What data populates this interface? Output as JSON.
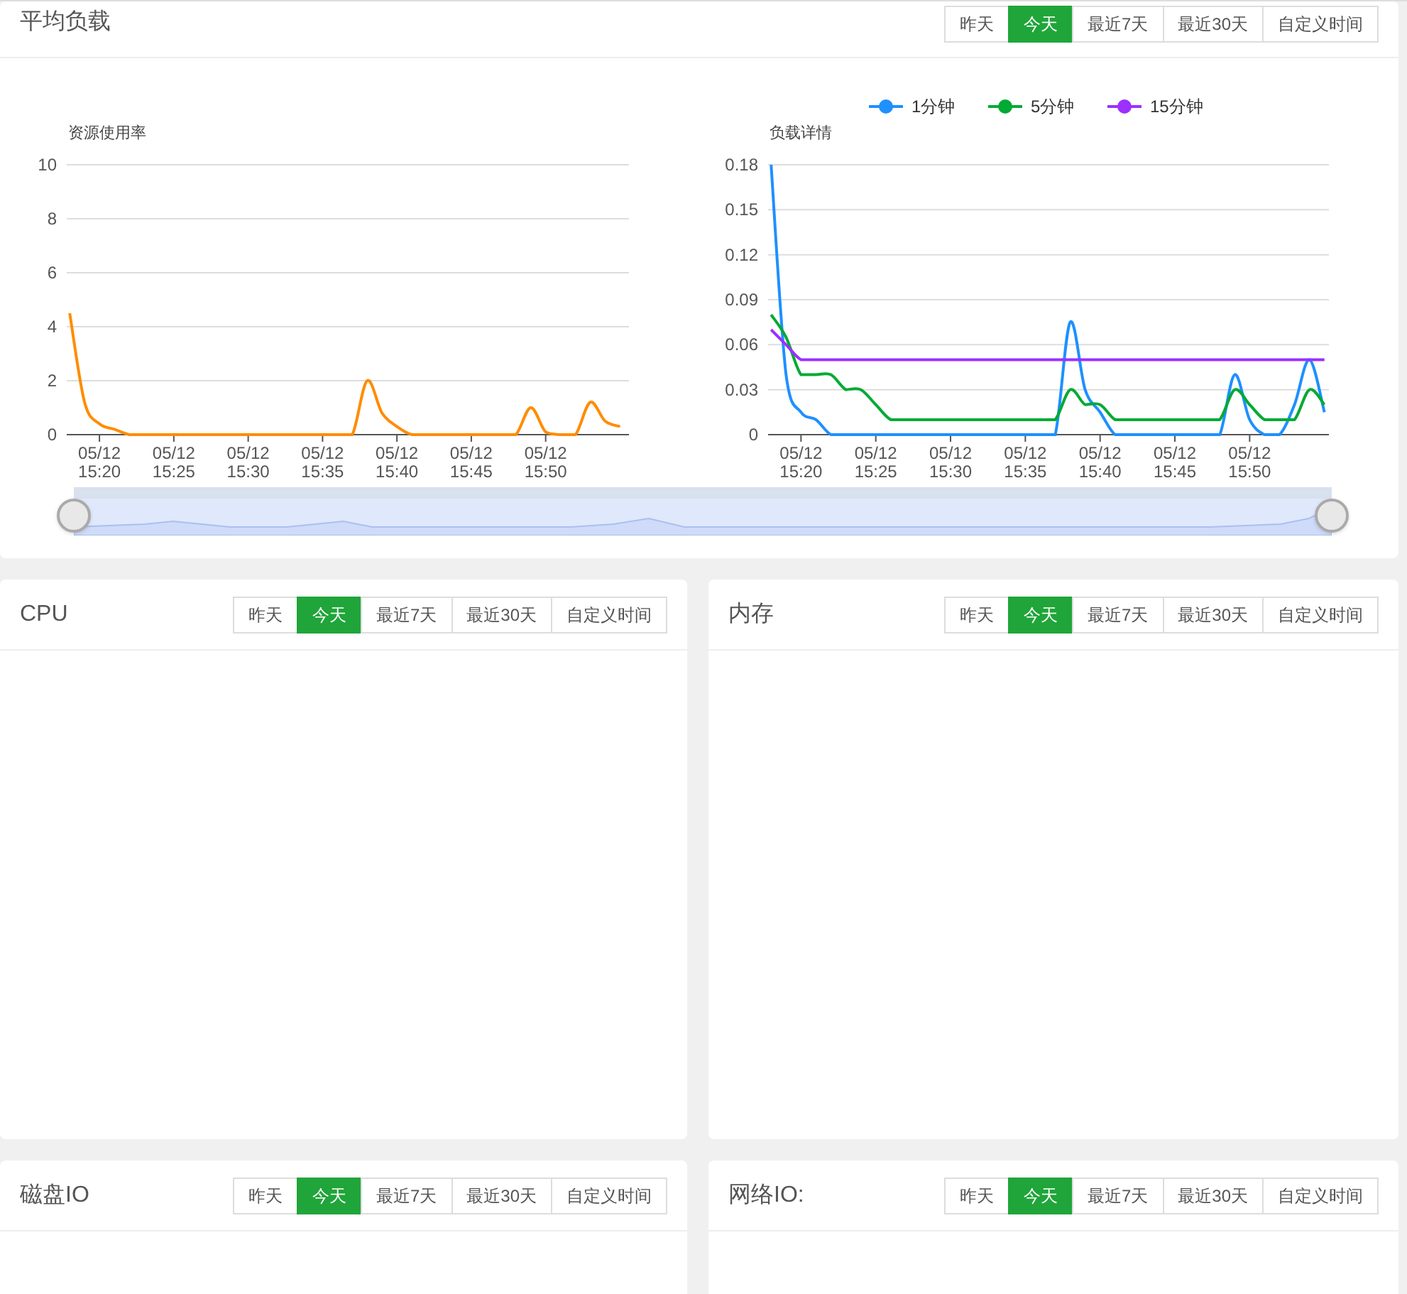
{
  "panels": [
    {
      "title": "平均负载",
      "ranges": [
        {
          "label": "昨天",
          "selected": false
        },
        {
          "label": "今天",
          "selected": true
        },
        {
          "label": "最近7天",
          "selected": false
        },
        {
          "label": "最近30天",
          "selected": false
        },
        {
          "label": "自定义时间",
          "selected": false
        }
      ],
      "charts": [
        {
          "chart_data": {
            "type": "line",
            "grid": true,
            "ylabel": "资源使用率",
            "categories": [
              null,
              null,
              "05/12 15:20",
              null,
              null,
              null,
              null,
              "05/12 15:25",
              null,
              null,
              null,
              null,
              "05/12 15:30",
              null,
              null,
              null,
              null,
              "05/12 15:35",
              null,
              null,
              null,
              null,
              "05/12 15:40",
              null,
              null,
              null,
              null,
              "05/12 15:45",
              null,
              null,
              null,
              null,
              "05/12 15:50",
              null,
              null,
              null,
              null,
              null
            ],
            "ylim": [
              0,
              10
            ],
            "yticks": [
              0,
              2,
              4,
              6,
              8,
              10
            ],
            "series": [
              {
                "color": "#ff8c00",
                "values": [
                  4.5,
                  1.2,
                  0.4,
                  0.2,
                  0,
                  0,
                  0,
                  0,
                  0,
                  0,
                  0,
                  0,
                  0,
                  0,
                  0,
                  0,
                  0,
                  0,
                  0,
                  0,
                  2.0,
                  0.8,
                  0.3,
                  0,
                  0,
                  0,
                  0,
                  0,
                  0,
                  0,
                  0,
                  1.0,
                  0.1,
                  0,
                  0,
                  1.2,
                  0.5,
                  0.3
                ]
              }
            ]
          }
        },
        {
          "chart_data": {
            "type": "line",
            "grid": true,
            "legend": "top",
            "ylabel": "负载详情",
            "categories": [
              null,
              null,
              "05/12 15:20",
              null,
              null,
              null,
              null,
              "05/12 15:25",
              null,
              null,
              null,
              null,
              "05/12 15:30",
              null,
              null,
              null,
              null,
              "05/12 15:35",
              null,
              null,
              null,
              null,
              "05/12 15:40",
              null,
              null,
              null,
              null,
              "05/12 15:45",
              null,
              null,
              null,
              null,
              "05/12 15:50",
              null,
              null,
              null,
              null,
              null
            ],
            "ylim": [
              0,
              0.18
            ],
            "yticks": [
              0,
              0.03,
              0.06,
              0.09,
              0.12,
              0.15,
              0.18
            ],
            "series": [
              {
                "name": "1分钟",
                "color": "#1e90ff",
                "values": [
                  0.18,
                  0.04,
                  0.015,
                  0.01,
                  0,
                  0,
                  0,
                  0,
                  0,
                  0,
                  0,
                  0,
                  0,
                  0,
                  0,
                  0,
                  0,
                  0,
                  0,
                  0,
                  0.075,
                  0.03,
                  0.015,
                  0,
                  0,
                  0,
                  0,
                  0,
                  0,
                  0,
                  0,
                  0.04,
                  0.01,
                  0,
                  0,
                  0.02,
                  0.05,
                  0.015
                ]
              },
              {
                "name": "5分钟",
                "color": "#00aa33",
                "values": [
                  0.08,
                  0.065,
                  0.04,
                  0.04,
                  0.04,
                  0.03,
                  0.03,
                  0.02,
                  0.01,
                  0.01,
                  0.01,
                  0.01,
                  0.01,
                  0.01,
                  0.01,
                  0.01,
                  0.01,
                  0.01,
                  0.01,
                  0.01,
                  0.03,
                  0.02,
                  0.02,
                  0.01,
                  0.01,
                  0.01,
                  0.01,
                  0.01,
                  0.01,
                  0.01,
                  0.01,
                  0.03,
                  0.02,
                  0.01,
                  0.01,
                  0.01,
                  0.03,
                  0.02
                ]
              },
              {
                "name": "15分钟",
                "color": "#9b30ff",
                "values": [
                  0.07,
                  0.06,
                  0.05,
                  0.05,
                  0.05,
                  0.05,
                  0.05,
                  0.05,
                  0.05,
                  0.05,
                  0.05,
                  0.05,
                  0.05,
                  0.05,
                  0.05,
                  0.05,
                  0.05,
                  0.05,
                  0.05,
                  0.05,
                  0.05,
                  0.05,
                  0.05,
                  0.05,
                  0.05,
                  0.05,
                  0.05,
                  0.05,
                  0.05,
                  0.05,
                  0.05,
                  0.05,
                  0.05,
                  0.05,
                  0.05,
                  0.05,
                  0.05,
                  0.05
                ]
              }
            ]
          }
        }
      ],
      "zoom": {
        "level": 1
      }
    },
    {
      "title": "CPU",
      "ranges": [
        {
          "label": "昨天",
          "selected": false
        },
        {
          "label": "今天",
          "selected": true
        },
        {
          "label": "最近7天",
          "selected": false
        },
        {
          "label": "最近30天",
          "selected": false
        },
        {
          "label": "自定义时间",
          "selected": false
        }
      ]
    },
    {
      "title": "内存",
      "ranges": [
        {
          "label": "昨天",
          "selected": false
        },
        {
          "label": "今天",
          "selected": true
        },
        {
          "label": "最近7天",
          "selected": false
        },
        {
          "label": "最近30天",
          "selected": false
        },
        {
          "label": "自定义时间",
          "selected": false
        }
      ]
    },
    {
      "title": "磁盘IO",
      "ranges": [
        {
          "label": "昨天",
          "selected": false
        },
        {
          "label": "今天",
          "selected": true
        },
        {
          "label": "最近7天",
          "selected": false
        },
        {
          "label": "最近30天",
          "selected": false
        },
        {
          "label": "自定义时间",
          "selected": false
        }
      ]
    },
    {
      "title": "网络IO:",
      "ranges": [
        {
          "label": "昨天",
          "selected": false
        },
        {
          "label": "今天",
          "selected": true
        },
        {
          "label": "最近7天",
          "selected": false
        },
        {
          "label": "最近30天",
          "selected": false
        },
        {
          "label": "自定义时间",
          "selected": false
        }
      ]
    }
  ]
}
